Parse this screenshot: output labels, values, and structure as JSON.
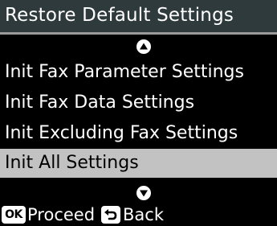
{
  "header": {
    "title": "Restore Default Settings"
  },
  "menu": {
    "items": [
      {
        "label": "Init Fax Parameter Settings",
        "selected": false
      },
      {
        "label": "Init Fax Data Settings",
        "selected": false
      },
      {
        "label": "Init Excluding Fax Settings",
        "selected": false
      },
      {
        "label": "Init All Settings",
        "selected": true
      }
    ]
  },
  "scroll": {
    "up_icon": "triangle-up-icon",
    "down_icon": "triangle-down-icon"
  },
  "footer": {
    "ok_key": "OK",
    "proceed_label": "Proceed",
    "back_icon": "back-arrow-icon",
    "back_label": "Back"
  },
  "colors": {
    "background": "#000000",
    "title_bar": "#2f3a3c",
    "divider": "#9a9a9a",
    "selected_row": "#c2c2c2",
    "text": "#ffffff",
    "selected_text": "#000000"
  }
}
